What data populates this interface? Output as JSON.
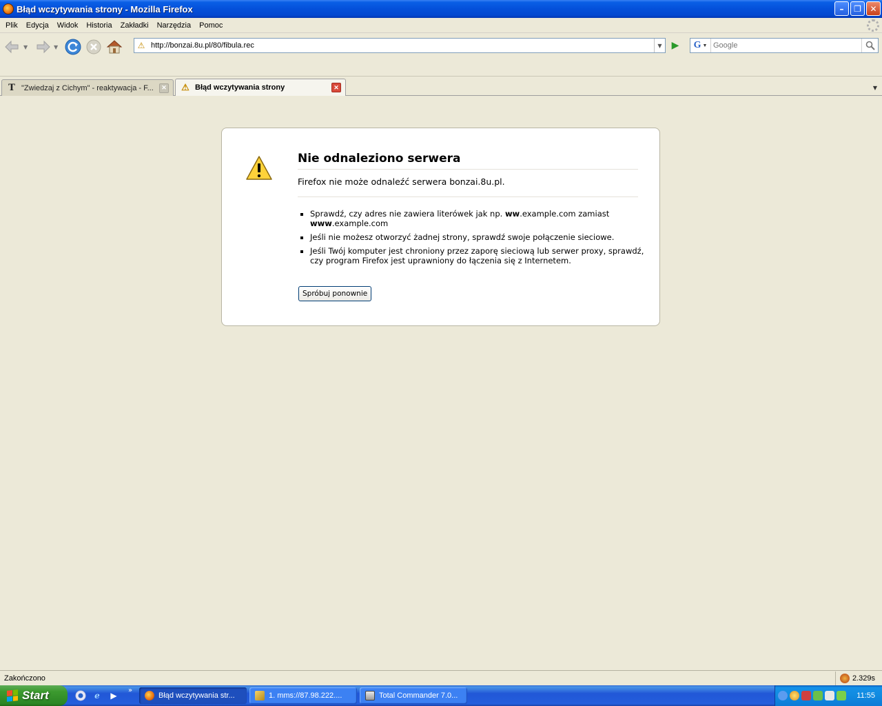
{
  "window": {
    "title": "Błąd wczytywania strony - Mozilla Firefox"
  },
  "menu": [
    "Plik",
    "Edycja",
    "Widok",
    "Historia",
    "Zakładki",
    "Narzędzia",
    "Pomoc"
  ],
  "nav": {
    "url": "http://bonzai.8u.pl/80/fibula.rec",
    "search_placeholder": "Google"
  },
  "tabs": [
    {
      "label": "\"Zwiedzaj z Cichym\" - reaktywacja - F...",
      "icon": "tumblr-t-icon",
      "active": false
    },
    {
      "label": "Błąd wczytywania strony",
      "icon": "warning-icon",
      "active": true
    }
  ],
  "error": {
    "title": "Nie odnaleziono serwera",
    "description": "Firefox nie może odnaleźć serwera bonzai.8u.pl.",
    "tips": [
      {
        "pre": "Sprawdź, czy adres nie zawiera literówek jak np. ",
        "bold1": "ww",
        "mid": ".example.com zamiast ",
        "bold2": "www",
        "post": ".example.com"
      },
      {
        "text": "Jeśli nie możesz otworzyć żadnej strony, sprawdź swoje połączenie sieciowe."
      },
      {
        "text": "Jeśli Twój komputer jest chroniony przez zaporę sieciową lub serwer proxy, sprawdź, czy program Firefox jest uprawniony do łączenia się z Internetem."
      }
    ],
    "retry_label": "Spróbuj ponownie"
  },
  "status": {
    "text": "Zakończono",
    "timing": "2.329s"
  },
  "taskbar": {
    "start_label": "Start",
    "tasks": [
      {
        "label": "Błąd wczytywania str...",
        "active": true
      },
      {
        "label": "1. mms://87.98.222....",
        "active": false
      },
      {
        "label": "Total Commander 7.0...",
        "active": false
      }
    ],
    "clock": "11:55"
  },
  "colors": {
    "title_bar": "#0450da",
    "page_bg": "#ece9d8",
    "start_green": "#3c9a2f",
    "taskbar_blue": "#245edc"
  }
}
